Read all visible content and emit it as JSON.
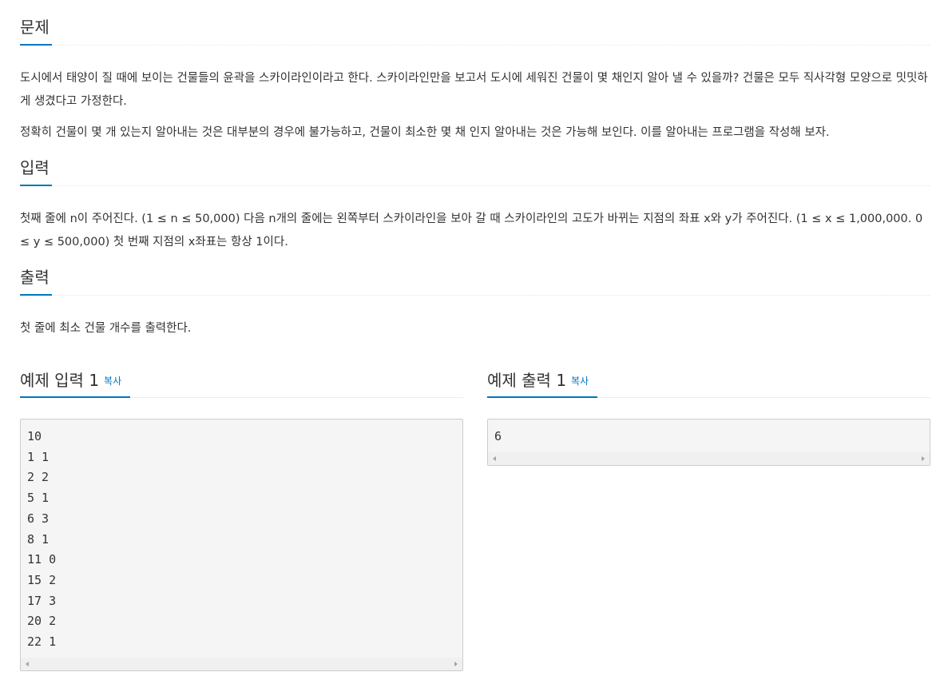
{
  "problem": {
    "title": "문제",
    "paragraphs": [
      "도시에서 태양이 질 때에 보이는 건물들의 윤곽을 스카이라인이라고 한다. 스카이라인만을 보고서 도시에 세워진 건물이 몇 채인지 알아 낼 수 있을까? 건물은 모두 직사각형 모양으로 밋밋하게 생겼다고 가정한다.",
      "정확히 건물이 몇 개 있는지 알아내는 것은 대부분의 경우에 불가능하고, 건물이 최소한 몇 채 인지 알아내는 것은 가능해 보인다. 이를 알아내는 프로그램을 작성해 보자."
    ]
  },
  "input": {
    "title": "입력",
    "text": "첫째 줄에 n이 주어진다. (1 ≤ n ≤ 50,000) 다음 n개의 줄에는 왼쪽부터 스카이라인을 보아 갈 때 스카이라인의 고도가 바뀌는 지점의 좌표 x와 y가 주어진다. (1 ≤ x ≤ 1,000,000. 0 ≤ y ≤ 500,000) 첫 번째 지점의 x좌표는 항상 1이다."
  },
  "output": {
    "title": "출력",
    "text": "첫 줄에 최소 건물 개수를 출력한다."
  },
  "sample_input": {
    "title": "예제 입력 1",
    "copy_label": "복사",
    "content": "10\n1 1\n2 2\n5 1\n6 3\n8 1\n11 0\n15 2\n17 3\n20 2\n22 1"
  },
  "sample_output": {
    "title": "예제 출력 1",
    "copy_label": "복사",
    "content": "6"
  },
  "colors": {
    "accent": "#0076c0",
    "text": "#333333",
    "pre_background": "#f5f5f5",
    "pre_border": "#cccccc"
  }
}
